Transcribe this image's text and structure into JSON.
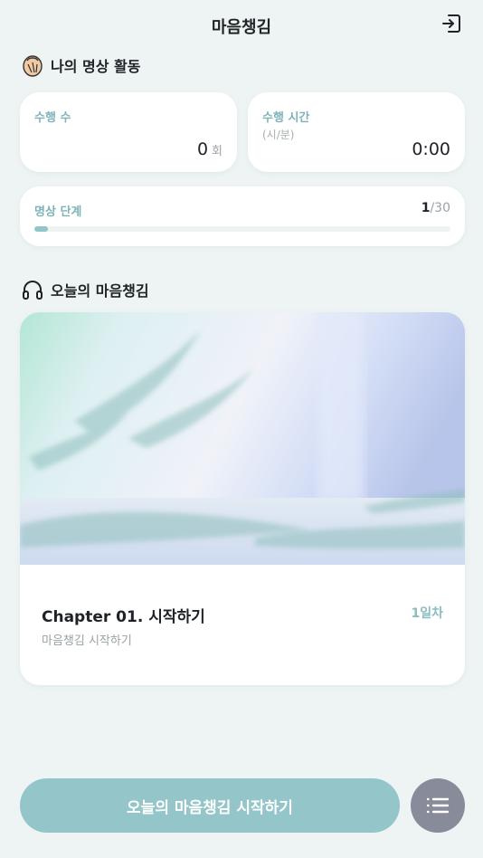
{
  "header": {
    "title": "마음챙김",
    "logout_icon": "logout-icon"
  },
  "activity": {
    "section_title": "나의 명상 활동",
    "section_icon": "hands-icon",
    "count": {
      "label": "수행 수",
      "value": "0",
      "unit": "회"
    },
    "time": {
      "label": "수행 시간",
      "sub": "(시/분)",
      "value": "0:00"
    },
    "stage": {
      "label": "명상 단계",
      "current": "1",
      "total": "/30",
      "progress_fraction": 0.033
    }
  },
  "today": {
    "section_title": "오늘의 마음챙김",
    "section_icon": "headphones-icon",
    "chapter_title": "Chapter 01. 시작하기",
    "chapter_day": "1일차",
    "chapter_subtitle": "마음챙김 시작하기"
  },
  "footer": {
    "start_label": "오늘의 마음챙김 시작하기",
    "menu_icon": "list-menu-icon"
  },
  "colors": {
    "accent": "#93c5c9",
    "label": "#7fb3b8",
    "menu_button": "#888b99",
    "background": "#eef4f4"
  }
}
